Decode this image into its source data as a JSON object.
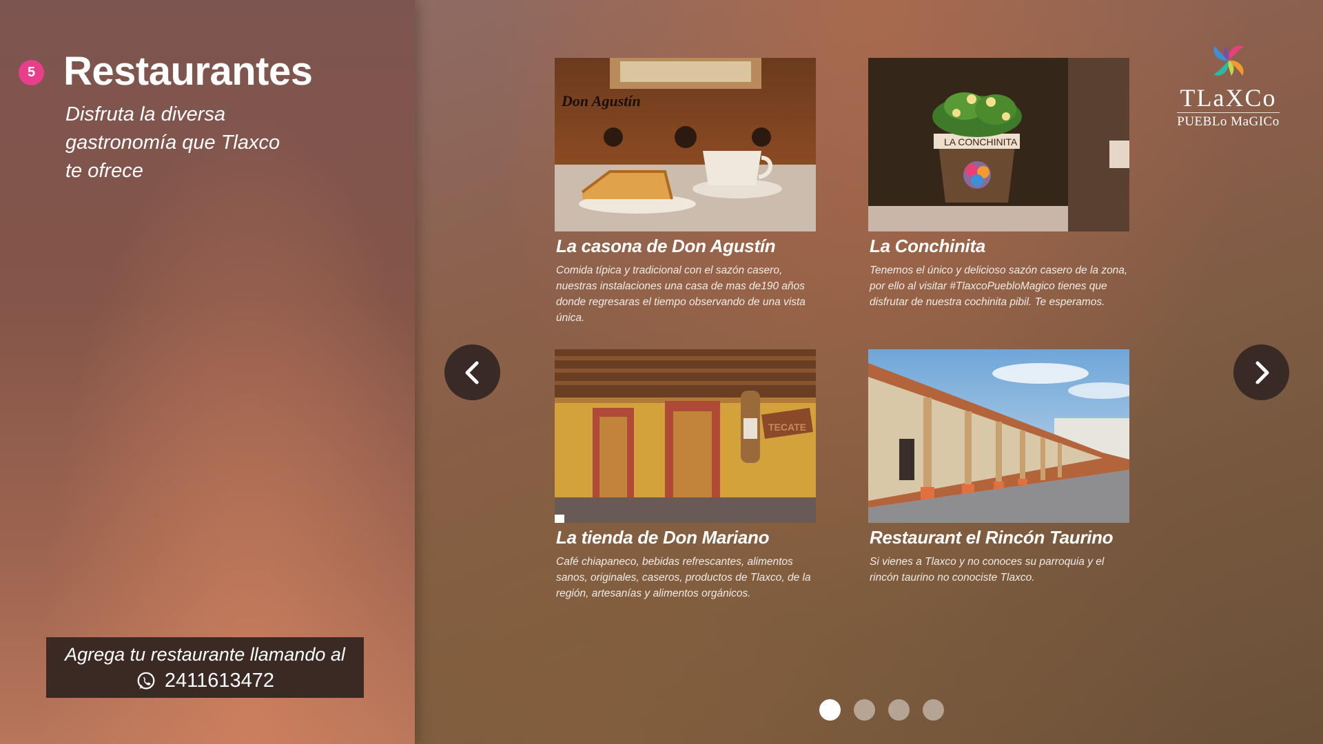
{
  "section": {
    "number": "5",
    "title": "Restaurantes",
    "subtitle": "Disfruta la diversa gastronomía que Tlaxco te ofrece"
  },
  "cta": {
    "text": "Agrega tu restaurante llamando al",
    "phone": "2411613472",
    "icon": "whatsapp-icon"
  },
  "logo": {
    "name": "TLaXCo",
    "tagline": "PUEBLo MaGICo",
    "colors": [
      "#e8407a",
      "#f39a2e",
      "#2fb7a6",
      "#7a4fa0",
      "#3e8fd6"
    ]
  },
  "restaurants": [
    {
      "name": "La casona de Don Agustín",
      "description": "Comida típica y tradicional con el sazón casero, nuestras instalaciones una casa de mas de190 años donde regresaras el tiempo observando de una vista única.",
      "image_label": "Don Agustín"
    },
    {
      "name": "La Conchinita",
      "description": "Tenemos el único y delicioso sazón casero de la zona, por ello al visitar #TlaxcoPuebloMagico tienes que disfrutar de nuestra cochinita pibil. Te esperamos.",
      "image_label": "LA CONCHINITA"
    },
    {
      "name": "La tienda de Don Mariano",
      "description": "Café chiapaneco, bebidas refrescantes, alimentos sanos, originales, caseros, productos de Tlaxco, de la región, artesanías y alimentos orgánicos.",
      "image_label": "TECATE"
    },
    {
      "name": "Restaurant el Rincón Taurino",
      "description": "Si vienes a Tlaxco y no conoces su parroquia y el rincón taurino no conociste Tlaxco."
    }
  ],
  "carousel": {
    "prev_icon": "chevron-left-icon",
    "next_icon": "chevron-right-icon",
    "page_count": 4,
    "active_page": 1
  }
}
